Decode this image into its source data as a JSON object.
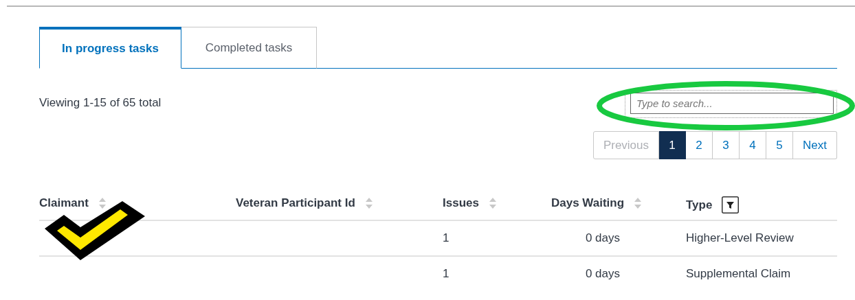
{
  "tabs": [
    {
      "label": "In progress tasks",
      "selected": true
    },
    {
      "label": "Completed tasks",
      "selected": false
    }
  ],
  "summary": "Viewing 1-15 of 65 total",
  "search": {
    "placeholder": "Type to search..."
  },
  "pagination": {
    "previous": {
      "label": "Previous",
      "disabled": true
    },
    "pages": [
      {
        "label": "1",
        "selected": true
      },
      {
        "label": "2",
        "selected": false
      },
      {
        "label": "3",
        "selected": false
      },
      {
        "label": "4",
        "selected": false
      },
      {
        "label": "5",
        "selected": false
      }
    ],
    "next": {
      "label": "Next",
      "disabled": false
    }
  },
  "table": {
    "columns": [
      {
        "label": "Claimant",
        "kind": "sort"
      },
      {
        "label": "Veteran Participant Id",
        "kind": "sort"
      },
      {
        "label": "Issues",
        "kind": "sort"
      },
      {
        "label": "Days Waiting",
        "kind": "sort"
      },
      {
        "label": "Type",
        "kind": "filter"
      }
    ],
    "rows": [
      {
        "issues": "1",
        "days_waiting": "0 days",
        "type": "Higher-Level Review"
      },
      {
        "issues": "1",
        "days_waiting": "0 days",
        "type": "Supplemental Claim"
      }
    ]
  }
}
